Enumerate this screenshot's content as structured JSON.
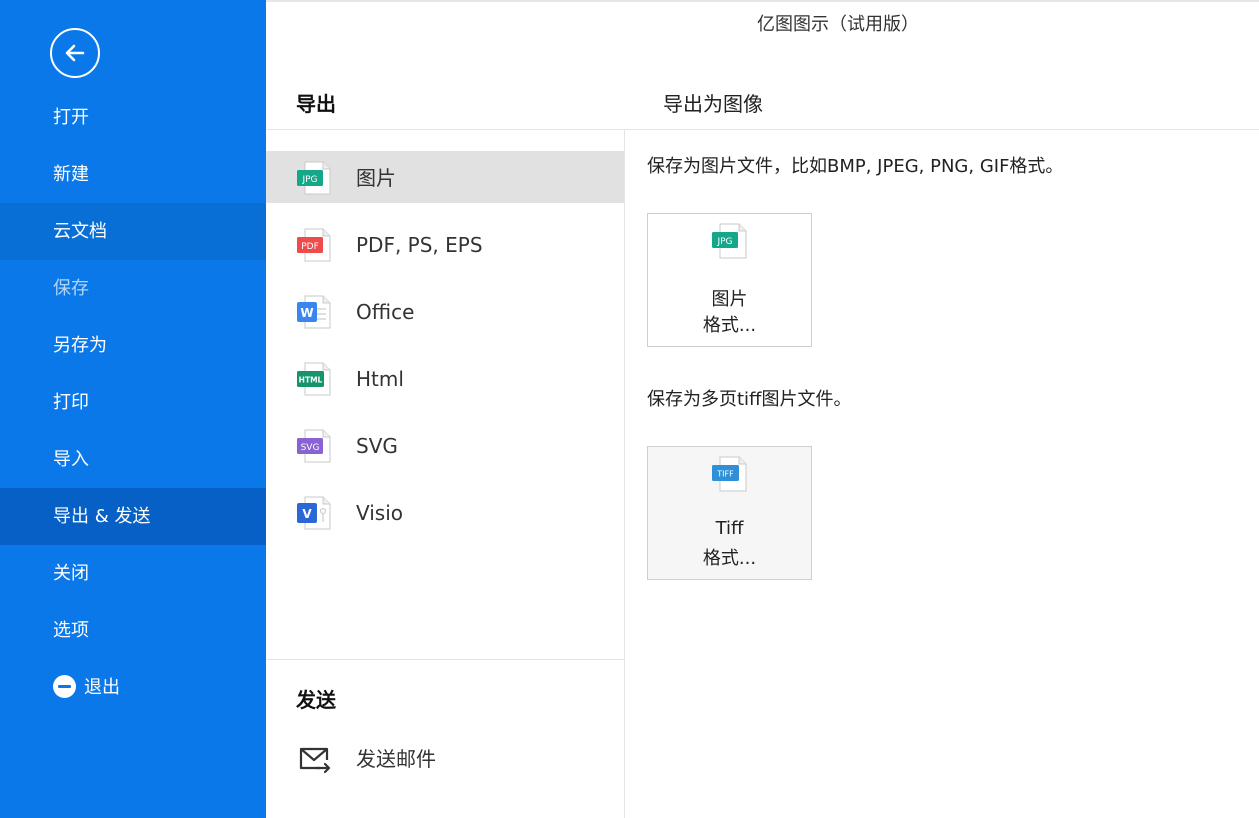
{
  "app_title": "亿图图示（试用版）",
  "sidebar": {
    "items": [
      {
        "label": "打开"
      },
      {
        "label": "新建"
      },
      {
        "label": "云文档"
      },
      {
        "label": "保存"
      },
      {
        "label": "另存为"
      },
      {
        "label": "打印"
      },
      {
        "label": "导入"
      },
      {
        "label": "导出 & 发送"
      },
      {
        "label": "关闭"
      },
      {
        "label": "选项"
      },
      {
        "label": "退出"
      }
    ],
    "active": "导出 & 发送",
    "disabled": [
      "保存"
    ],
    "icons": {
      "back": "back-arrow-icon",
      "exit": "minus-circle-icon"
    }
  },
  "export": {
    "heading": "导出",
    "formats": [
      {
        "label": "图片",
        "icon": "jpg-file-icon",
        "badge": "JPG",
        "color": "#16a68a"
      },
      {
        "label": "PDF, PS, EPS",
        "icon": "pdf-file-icon",
        "badge": "PDF",
        "color": "#ee4b4b"
      },
      {
        "label": "Office",
        "icon": "word-file-icon",
        "badge": "W",
        "color": "#3a86f0"
      },
      {
        "label": "Html",
        "icon": "html-file-icon",
        "badge": "HTML",
        "color": "#16946c"
      },
      {
        "label": "SVG",
        "icon": "svg-file-icon",
        "badge": "SVG",
        "color": "#8a63d2"
      },
      {
        "label": "Visio",
        "icon": "visio-file-icon",
        "badge": "V",
        "color": "#2a68d8"
      }
    ],
    "selected": "图片"
  },
  "send": {
    "heading": "发送",
    "email_label": "发送邮件",
    "icon": "mail-send-icon"
  },
  "panel": {
    "heading": "导出为图像",
    "desc_image": "保存为图片文件，比如BMP, JPEG, PNG, GIF格式。",
    "image_card": {
      "line1": "图片",
      "line2": "格式...",
      "badge": "JPG"
    },
    "desc_tiff": "保存为多页tiff图片文件。",
    "tiff_card": {
      "line1": "Tiff",
      "line2": "格式...",
      "badge": "TIFF"
    }
  },
  "colors": {
    "sidebar_bg": "#0a78e8",
    "sidebar_active": "#0760c5",
    "selected_row": "#e1e1e1"
  }
}
